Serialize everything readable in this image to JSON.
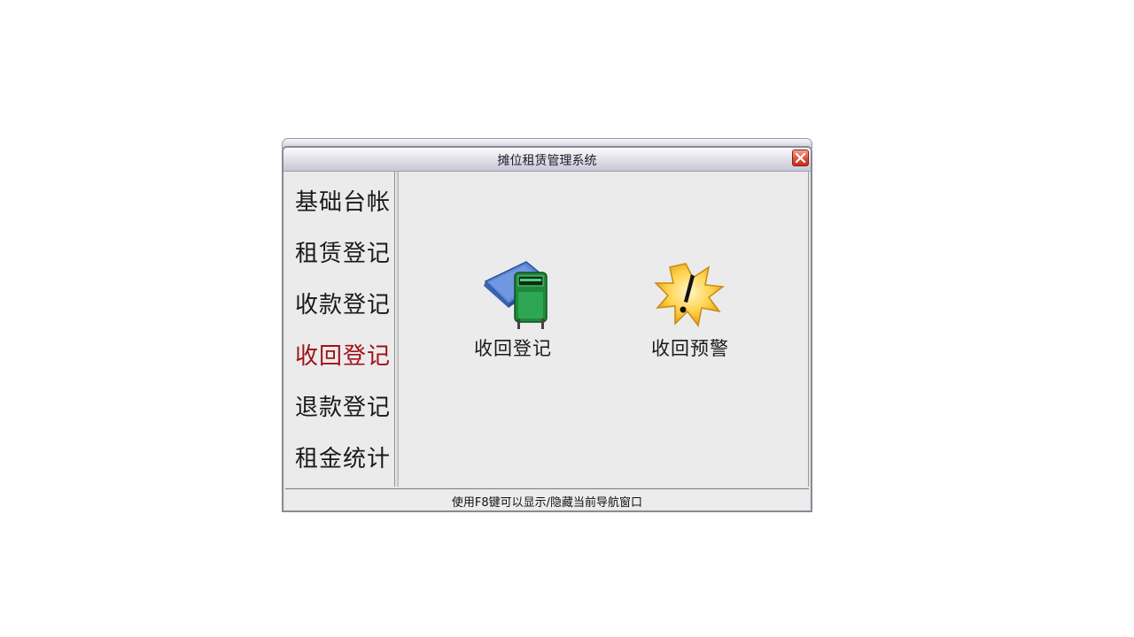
{
  "window": {
    "title": "摊位租赁管理系统",
    "close_icon": "close-icon"
  },
  "sidebar": {
    "items": [
      {
        "label": "基础台帐",
        "active": false
      },
      {
        "label": "租赁登记",
        "active": false
      },
      {
        "label": "收款登记",
        "active": false
      },
      {
        "label": "收回登记",
        "active": true
      },
      {
        "label": "退款登记",
        "active": false
      },
      {
        "label": "租金统计",
        "active": false
      }
    ]
  },
  "main": {
    "launchers": [
      {
        "label": "收回登记",
        "icon": "register-book-icon"
      },
      {
        "label": "收回预警",
        "icon": "warning-burst-icon"
      }
    ]
  },
  "statusbar": {
    "text": "使用F8键可以显示/隐藏当前导航窗口"
  },
  "colors": {
    "active_item": "#a01218",
    "close_button": "#dd5438",
    "frame": "#8a8a96"
  }
}
